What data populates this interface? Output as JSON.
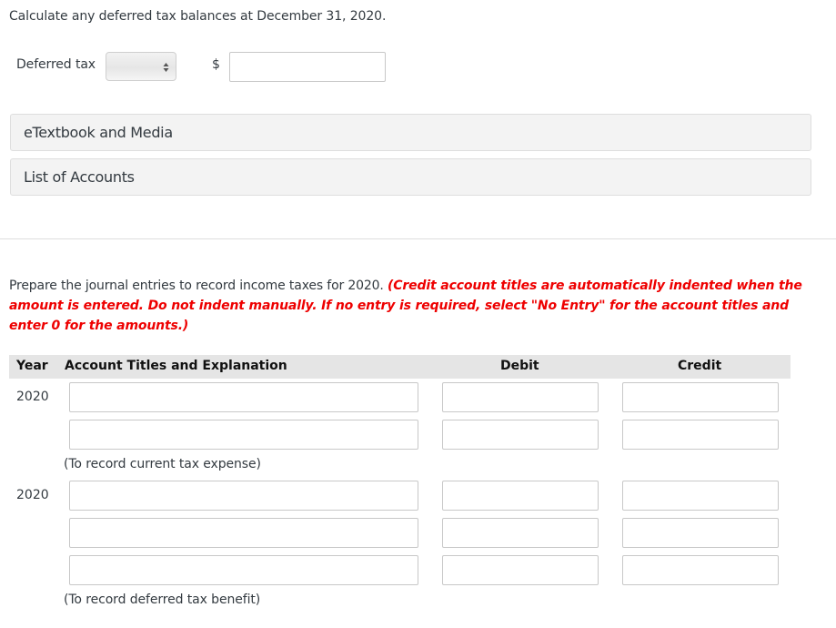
{
  "part_a": {
    "question": "Calculate any deferred tax balances at December 31, 2020.",
    "deferred_tax_label": "Deferred tax",
    "deferred_tax_select_value": "",
    "currency_symbol": "$",
    "amount_value": ""
  },
  "resources": [
    {
      "label": "eTextbook and Media"
    },
    {
      "label": "List of Accounts"
    }
  ],
  "part_b": {
    "question_prefix": "Prepare the journal entries to record income taxes for 2020. ",
    "instruction": "(Credit account titles are automatically indented when the amount is entered. Do not indent manually. If no entry is required, select \"No Entry\" for the account titles and enter 0 for the amounts.)",
    "instruction_color": "#ee0000"
  },
  "journal": {
    "headers": {
      "year": "Year",
      "account": "Account Titles and Explanation",
      "debit": "Debit",
      "credit": "Credit"
    },
    "entries": [
      {
        "year": "2020",
        "rows": [
          {
            "account": "",
            "debit": "",
            "credit": ""
          },
          {
            "account": "",
            "debit": "",
            "credit": ""
          }
        ],
        "memo": "(To record current tax expense)"
      },
      {
        "year": "2020",
        "rows": [
          {
            "account": "",
            "debit": "",
            "credit": ""
          },
          {
            "account": "",
            "debit": "",
            "credit": ""
          },
          {
            "account": "",
            "debit": "",
            "credit": ""
          }
        ],
        "memo": "(To record deferred tax benefit)"
      }
    ]
  }
}
